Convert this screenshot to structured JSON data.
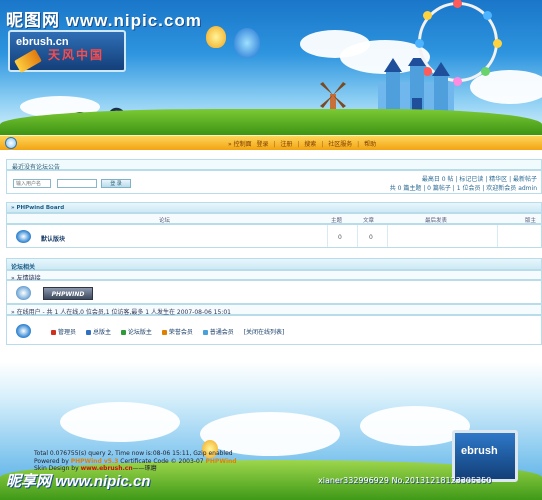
{
  "watermark": {
    "top": "昵图网 www.nipic.com",
    "bottom": "昵享网 www.nipic.cn",
    "id": "xianer332996929 No.20131218123305350"
  },
  "logo": {
    "brand": "ebrush.cn",
    "cn": "天风中国"
  },
  "nav": {
    "items": [
      "» 控制面",
      "登录",
      "注册",
      "搜索",
      "社区服务",
      "帮助"
    ]
  },
  "announce": "最近没有论坛公告",
  "login": {
    "username_placeholder": "输入用户名",
    "password_placeholder": "",
    "button": "登 录",
    "right_line1": "最高日 0 帖 | 标记已读 | 精华区 | 最新帖子",
    "right_line2": "共 0 篇主题 | 0 篇帖子 | 1 位会员 | 欢迎新会员 admin"
  },
  "board": {
    "title": "» PHPwind Board",
    "headers": {
      "forum": "论坛",
      "topics": "主题",
      "posts": "文章",
      "last": "最后发表",
      "mod": "版主"
    },
    "rows": [
      {
        "name": "默认版块",
        "topics": "0",
        "posts": "0"
      }
    ]
  },
  "related": {
    "title": "论坛相关",
    "links_label": "» 友情链接",
    "phpwind_logo": "PHPWIND",
    "online_line": "» 在线用户 - 共 1 人在线,0 位会员,1 位访客,最多 1 人发生在 2007-08-06 15:01",
    "legend": [
      {
        "label": "管理员",
        "color": "#d03020"
      },
      {
        "label": "总版主",
        "color": "#3070c0"
      },
      {
        "label": "论坛版主",
        "color": "#2f9a3a"
      },
      {
        "label": "荣誉会员",
        "color": "#e08000"
      },
      {
        "label": "普通会员",
        "color": "#4aa0d8"
      },
      {
        "label": "[关闭在线列表]",
        "color": ""
      }
    ]
  },
  "footer": {
    "line1": "Total 0.076755(s) query 2, Time now is:08-06 15:11, Gzip enabled",
    "line2_pre": "Powered by ",
    "line2_brand": "PHPWind v5.3",
    "line2_mid": " Certificate Code © 2003-07 ",
    "line2_brand2": "PHPWind",
    "line3_pre": "Skin Design by ",
    "line3_link": "www.ebrush.cn",
    "line3_suffix": "——琢磨",
    "monitor": "ebrush"
  }
}
